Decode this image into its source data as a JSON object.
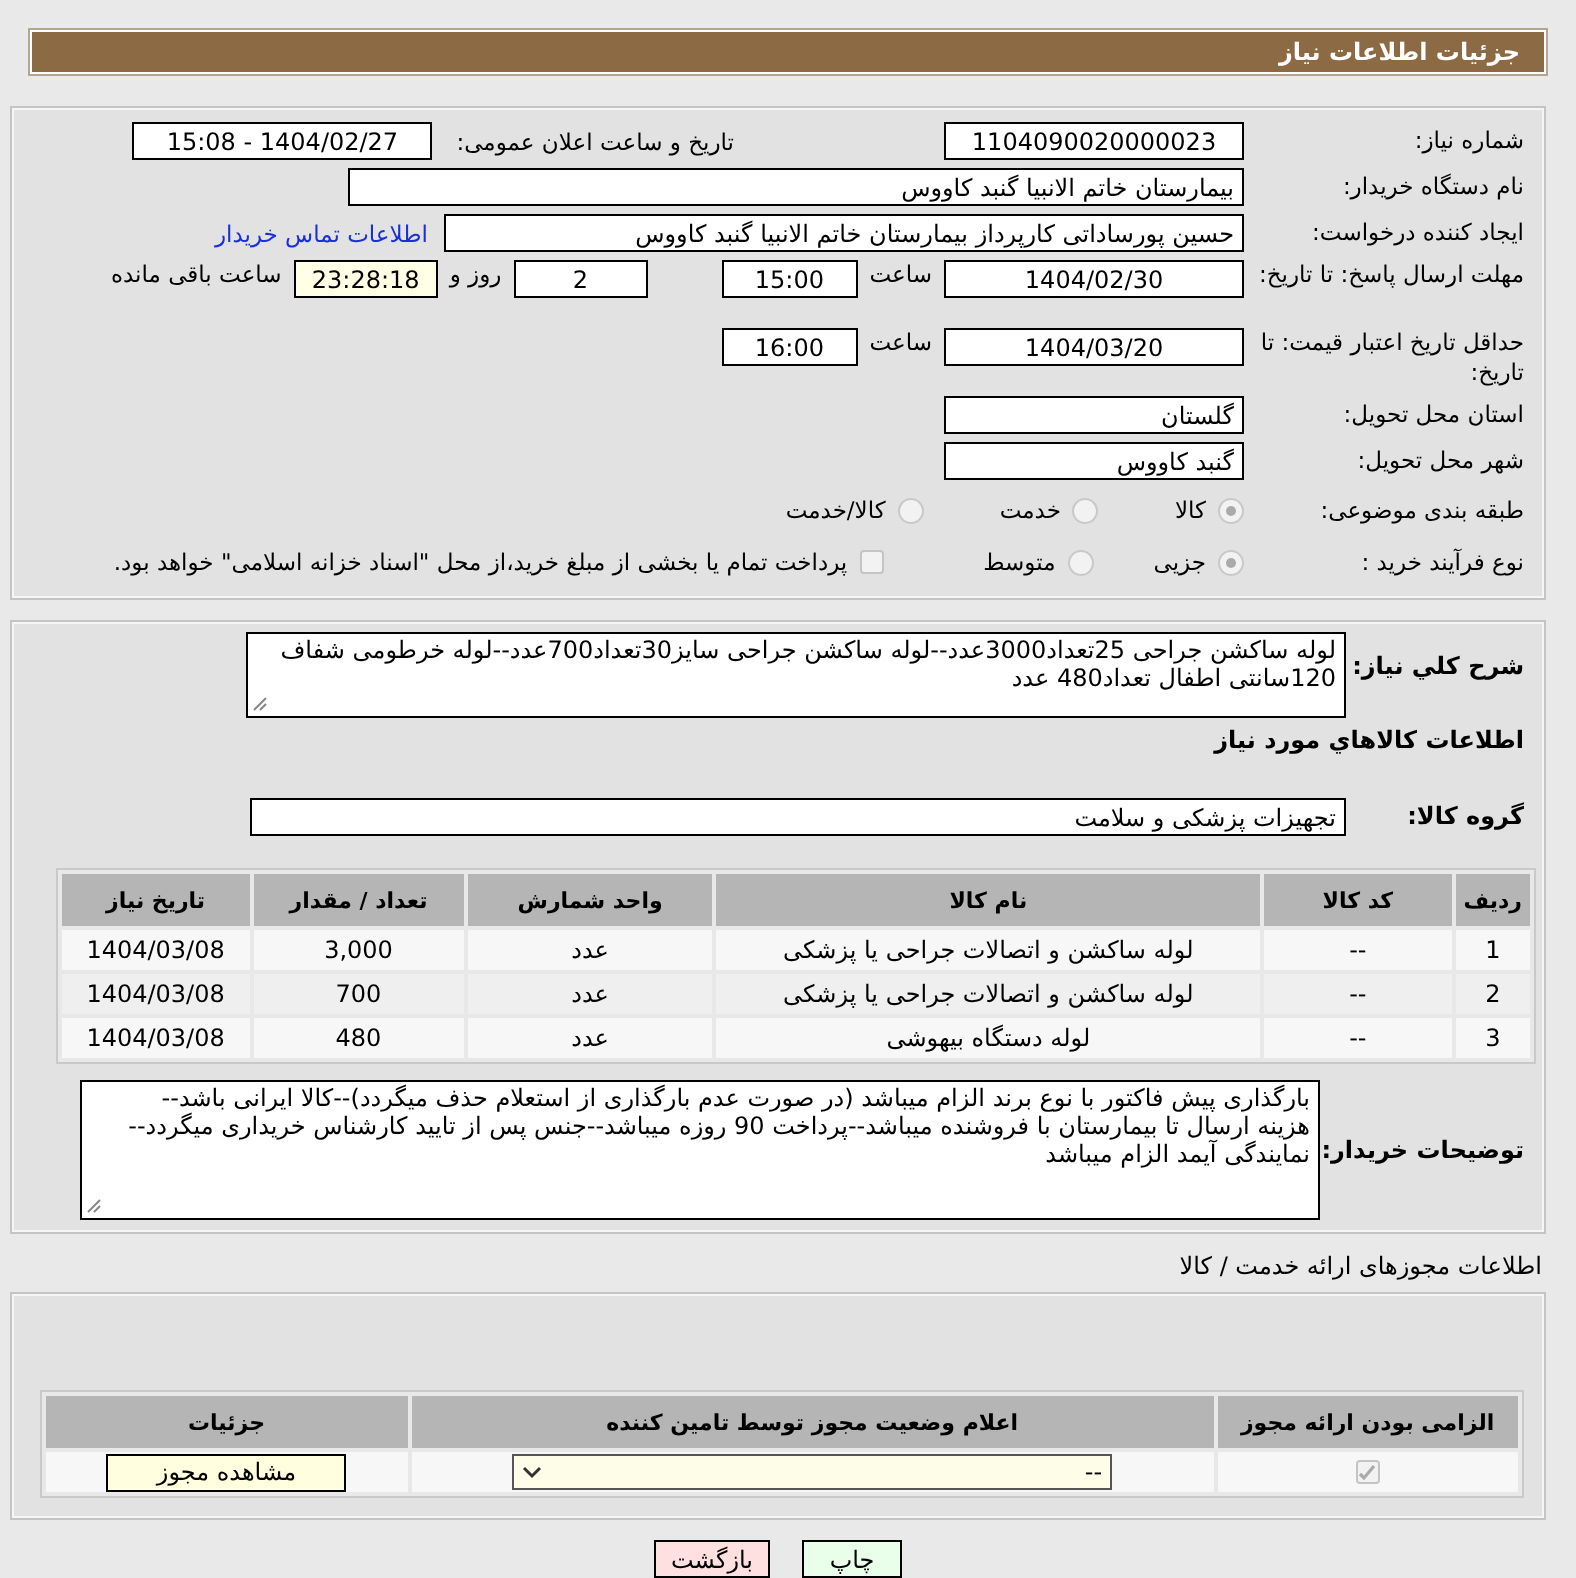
{
  "header": {
    "title": "جزئیات اطلاعات نیاز"
  },
  "summary": {
    "need_number": {
      "label": "شماره نیاز:",
      "value": "1104090020000023"
    },
    "announce": {
      "label": "تاریخ و ساعت اعلان عمومی:",
      "value": "1404/02/27 - 15:08"
    },
    "buyer_org": {
      "label": "نام دستگاه خریدار:",
      "value": "بیمارستان خاتم الانبیا گنبد کاووس"
    },
    "requester": {
      "label": "ایجاد کننده درخواست:",
      "value": "حسین پورساداتی کارپرداز بیمارستان خاتم الانبیا گنبد کاووس",
      "link": "اطلاعات تماس خریدار"
    },
    "deadline": {
      "label": "مهلت ارسال پاسخ: تا تاریخ:",
      "date": "1404/02/30",
      "time_label": "ساعت",
      "time": "15:00",
      "days": "2",
      "days_label": "روز و",
      "remaining": "23:28:18",
      "remaining_label": "ساعت باقی مانده"
    },
    "price_validity": {
      "label": "حداقل تاریخ اعتبار قیمت: تا تاریخ:",
      "date": "1404/03/20",
      "time_label": "ساعت",
      "time": "16:00"
    },
    "province": {
      "label": "استان محل تحویل:",
      "value": "گلستان"
    },
    "city": {
      "label": "شهر محل تحویل:",
      "value": "گنبد کاووس"
    },
    "category": {
      "label": "طبقه بندی موضوعی:",
      "options": [
        {
          "label": "کالا",
          "selected": true
        },
        {
          "label": "خدمت",
          "selected": false
        },
        {
          "label": "کالا/خدمت",
          "selected": false
        }
      ]
    },
    "process": {
      "label": "نوع فرآیند خرید :",
      "options": [
        {
          "label": "جزیی",
          "selected": true
        },
        {
          "label": "متوسط",
          "selected": false
        }
      ],
      "treasury": {
        "label": "پرداخت تمام یا بخشی از مبلغ خرید،از محل \"اسناد خزانه اسلامی\" خواهد بود.",
        "checked": false
      }
    }
  },
  "details": {
    "description": {
      "label": "شرح کلي نياز:",
      "value": "لوله ساکشن جراحی 25تعداد3000عدد--لوله ساکشن جراحی سایز30تعداد700عدد--لوله خرطومی شفاف 120سانتی اطفال تعداد480 عدد"
    },
    "goods_title": "اطلاعات کالاهاي مورد نياز",
    "group": {
      "label": "گروه کالا:",
      "value": "تجهیزات پزشکی و سلامت"
    },
    "table": {
      "columns": [
        "ردیف",
        "کد کالا",
        "نام کالا",
        "واحد شمارش",
        "تعداد / مقدار",
        "تاریخ نیاز"
      ],
      "rows": [
        [
          "1",
          "--",
          "لوله ساکشن و اتصالات جراحی یا پزشکی",
          "عدد",
          "3,000",
          "1404/03/08"
        ],
        [
          "2",
          "--",
          "لوله ساکشن و اتصالات جراحی یا پزشکی",
          "عدد",
          "700",
          "1404/03/08"
        ],
        [
          "3",
          "--",
          "لوله دستگاه بیهوشی",
          "عدد",
          "480",
          "1404/03/08"
        ]
      ]
    },
    "notes": {
      "label": "توضیحات خریدار:",
      "value": "بارگذاری پیش فاکتور با نوع برند الزام میباشد (در صورت عدم بارگذاری از استعلام حذف میگردد)--کالا ایرانی باشد--هزینه ارسال تا بیمارستان با فروشنده میباشد--پرداخت 90 روزه میباشد--جنس پس از تایید کارشناس خریداری میگردد--نمایندگی آیمد الزام میباشد"
    }
  },
  "licenses": {
    "title": "اطلاعات مجوزهای ارائه خدمت / کالا",
    "columns": [
      "الزامی بودن ارائه مجوز",
      "اعلام وضعیت مجوز توسط تامین کننده",
      "جزئیات"
    ],
    "rows": [
      {
        "required": true,
        "status": "--",
        "details_button": "مشاهده مجوز"
      }
    ]
  },
  "buttons": [
    {
      "label": "چاپ",
      "kind": "print"
    },
    {
      "label": "بازگشت",
      "kind": "back"
    }
  ]
}
